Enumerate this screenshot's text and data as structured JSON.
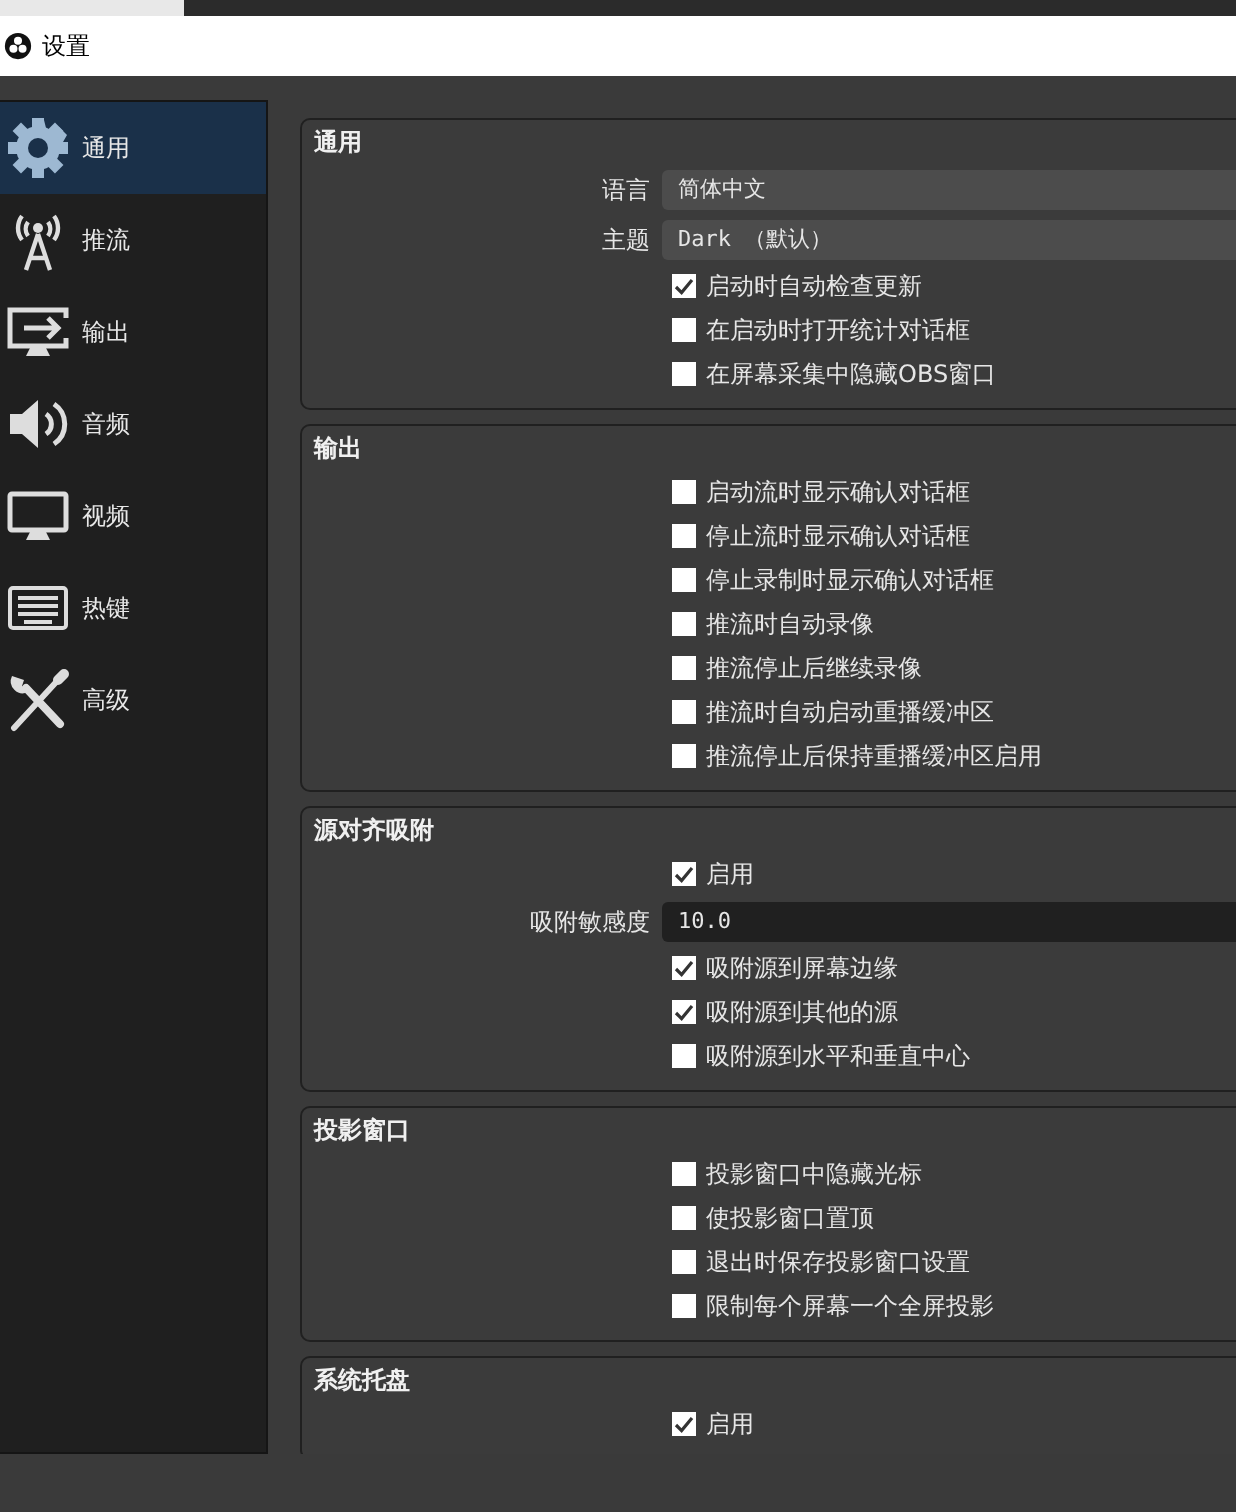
{
  "window": {
    "title": "设置"
  },
  "sidebar": {
    "items": [
      {
        "label": "通用",
        "kind": "gear",
        "selected": true
      },
      {
        "label": "推流",
        "kind": "antenna",
        "selected": false
      },
      {
        "label": "输出",
        "kind": "output",
        "selected": false
      },
      {
        "label": "音频",
        "kind": "speaker",
        "selected": false
      },
      {
        "label": "视频",
        "kind": "monitor",
        "selected": false
      },
      {
        "label": "热键",
        "kind": "keyboard",
        "selected": false
      },
      {
        "label": "高级",
        "kind": "tools",
        "selected": false
      }
    ]
  },
  "sections": [
    {
      "title": "通用",
      "rows": [
        {
          "kind": "select",
          "label": "语言",
          "value": "简体中文"
        },
        {
          "kind": "select",
          "label": "主题",
          "value": "Dark （默认）"
        },
        {
          "kind": "checkbox",
          "label": "启动时自动检查更新",
          "checked": true
        },
        {
          "kind": "checkbox",
          "label": "在启动时打开统计对话框",
          "checked": false
        },
        {
          "kind": "checkbox",
          "label": "在屏幕采集中隐藏OBS窗口",
          "checked": false
        }
      ]
    },
    {
      "title": "输出",
      "rows": [
        {
          "kind": "checkbox",
          "label": "启动流时显示确认对话框",
          "checked": false
        },
        {
          "kind": "checkbox",
          "label": "停止流时显示确认对话框",
          "checked": false
        },
        {
          "kind": "checkbox",
          "label": "停止录制时显示确认对话框",
          "checked": false
        },
        {
          "kind": "checkbox",
          "label": "推流时自动录像",
          "checked": false
        },
        {
          "kind": "checkbox",
          "label": "推流停止后继续录像",
          "checked": false
        },
        {
          "kind": "checkbox",
          "label": "推流时自动启动重播缓冲区",
          "checked": false
        },
        {
          "kind": "checkbox",
          "label": "推流停止后保持重播缓冲区启用",
          "checked": false
        }
      ]
    },
    {
      "title": "源对齐吸附",
      "rows": [
        {
          "kind": "checkbox",
          "label": "启用",
          "checked": true
        },
        {
          "kind": "number",
          "label": "吸附敏感度",
          "value": "10.0"
        },
        {
          "kind": "checkbox",
          "label": "吸附源到屏幕边缘",
          "checked": true
        },
        {
          "kind": "checkbox",
          "label": "吸附源到其他的源",
          "checked": true
        },
        {
          "kind": "checkbox",
          "label": "吸附源到水平和垂直中心",
          "checked": false
        }
      ]
    },
    {
      "title": "投影窗口",
      "rows": [
        {
          "kind": "checkbox",
          "label": "投影窗口中隐藏光标",
          "checked": false
        },
        {
          "kind": "checkbox",
          "label": "使投影窗口置顶",
          "checked": false
        },
        {
          "kind": "checkbox",
          "label": "退出时保存投影窗口设置",
          "checked": false
        },
        {
          "kind": "checkbox",
          "label": "限制每个屏幕一个全屏投影",
          "checked": false
        }
      ]
    },
    {
      "title": "系统托盘",
      "rows": [
        {
          "kind": "checkbox",
          "label": "启用",
          "checked": true
        }
      ]
    }
  ]
}
